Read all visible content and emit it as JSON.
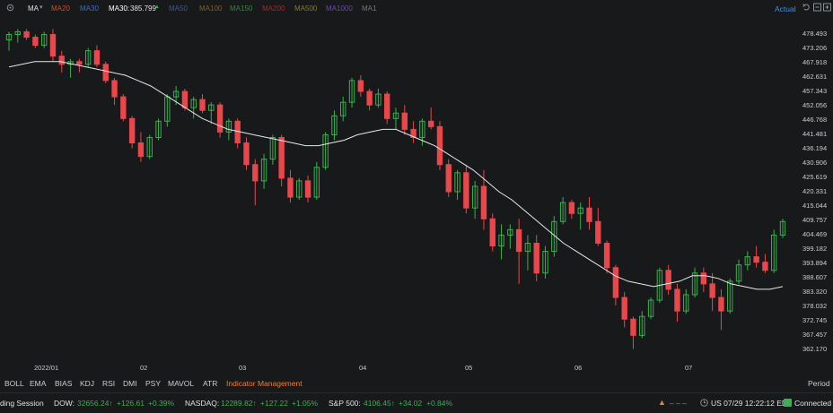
{
  "header": {
    "indicator_name": "MA",
    "ma_items": [
      {
        "label": "MA20",
        "color": "#b8573c",
        "value": ""
      },
      {
        "label": "MA30",
        "color": "#3f6fb1",
        "value": ""
      },
      {
        "label": "MA30:",
        "color": "#ffffff",
        "value": "385.799"
      },
      {
        "label": "MA50",
        "color": "#3a5a9a",
        "value": ""
      },
      {
        "label": "MA100",
        "color": "#8a5a2a",
        "value": ""
      },
      {
        "label": "MA150",
        "color": "#2f8a3f",
        "value": ""
      },
      {
        "label": "MA200",
        "color": "#a52a2a",
        "value": ""
      },
      {
        "label": "MA500",
        "color": "#8a7a2a",
        "value": ""
      },
      {
        "label": "MA1000",
        "color": "#6a4aa5",
        "value": ""
      },
      {
        "label": "MA1",
        "color": "#777777",
        "value": ""
      }
    ],
    "actual_label": "Actual"
  },
  "price_axis": [
    "478.493",
    "473.206",
    "467.918",
    "462.631",
    "457.343",
    "452.056",
    "446.768",
    "441.481",
    "436.194",
    "430.906",
    "425.619",
    "420.331",
    "415.044",
    "409.757",
    "404.469",
    "399.182",
    "393.894",
    "388.607",
    "383.320",
    "378.032",
    "372.745",
    "367.457",
    "362.170"
  ],
  "date_axis": [
    "2022/01",
    "02",
    "03",
    "04",
    "05",
    "06",
    "07"
  ],
  "indicator_tabs": [
    "BOLL",
    "EMA",
    "BIAS",
    "KDJ",
    "RSI",
    "DMI",
    "PSY",
    "MAVOL",
    "ATR",
    "Indicator Management"
  ],
  "period_label": "Period",
  "status": {
    "session": "ding Session",
    "dow_label": "DOW:",
    "dow_value": "32656.24↑",
    "dow_change": "+126.61",
    "dow_pct": "+0.39%",
    "nasdaq_label": "NASDAQ:",
    "nasdaq_value": "12289.82↑",
    "nasdaq_change": "+127.22",
    "nasdaq_pct": "+1.05%",
    "sp_label": "S&P 500:",
    "sp_value": "4106.45↑",
    "sp_change": "+34.02",
    "sp_pct": "+0.84%",
    "dashes": "– – –",
    "datetime": "US 07/29 12:22:12 EDT",
    "connection": "Connected"
  },
  "colors": {
    "up": "#34b34e",
    "down": "#e8474b",
    "ma": "#e8e8e8",
    "background": "#18191b",
    "accent": "#f27e2f",
    "actual": "#3d8ef0"
  },
  "chart_data": {
    "type": "candlestick",
    "ylim": [
      362.17,
      481
    ],
    "x_categories": [
      "2022/01",
      "02",
      "03",
      "04",
      "05",
      "06",
      "07"
    ],
    "ma_label": "MA30",
    "ma_last": 385.799,
    "candles": [
      [
        476,
        479,
        472,
        478
      ],
      [
        478,
        480,
        475,
        479
      ],
      [
        479,
        480,
        476,
        477
      ],
      [
        477,
        478,
        473,
        474
      ],
      [
        474,
        479,
        473,
        478
      ],
      [
        478,
        480,
        468,
        470
      ],
      [
        470,
        472,
        464,
        467
      ],
      [
        467,
        469,
        462,
        468
      ],
      [
        468,
        469,
        464,
        467
      ],
      [
        467,
        473,
        466,
        472
      ],
      [
        472,
        474,
        466,
        467
      ],
      [
        467,
        468,
        460,
        461
      ],
      [
        461,
        462,
        452,
        455
      ],
      [
        455,
        456,
        446,
        447
      ],
      [
        447,
        448,
        436,
        438
      ],
      [
        438,
        442,
        431,
        433
      ],
      [
        433,
        441,
        432,
        440
      ],
      [
        440,
        447,
        439,
        446
      ],
      [
        446,
        456,
        444,
        455
      ],
      [
        455,
        459,
        452,
        457
      ],
      [
        457,
        458,
        450,
        451
      ],
      [
        451,
        455,
        447,
        454
      ],
      [
        454,
        456,
        449,
        450
      ],
      [
        450,
        453,
        445,
        452
      ],
      [
        452,
        453,
        440,
        442
      ],
      [
        442,
        447,
        439,
        446
      ],
      [
        446,
        447,
        436,
        438
      ],
      [
        438,
        440,
        428,
        430
      ],
      [
        430,
        432,
        415,
        424
      ],
      [
        424,
        434,
        421,
        432
      ],
      [
        432,
        441,
        430,
        440
      ],
      [
        440,
        441,
        422,
        425
      ],
      [
        425,
        428,
        416,
        418
      ],
      [
        418,
        425,
        417,
        424
      ],
      [
        424,
        426,
        416,
        418
      ],
      [
        418,
        431,
        417,
        429
      ],
      [
        429,
        442,
        428,
        441
      ],
      [
        441,
        450,
        439,
        448
      ],
      [
        448,
        455,
        446,
        453
      ],
      [
        453,
        462,
        451,
        461
      ],
      [
        461,
        463,
        455,
        457
      ],
      [
        457,
        458,
        450,
        452
      ],
      [
        452,
        458,
        451,
        456
      ],
      [
        456,
        457,
        445,
        447
      ],
      [
        447,
        451,
        443,
        449
      ],
      [
        449,
        452,
        441,
        443
      ],
      [
        443,
        446,
        438,
        440
      ],
      [
        440,
        447,
        437,
        446
      ],
      [
        446,
        451,
        443,
        444
      ],
      [
        444,
        446,
        428,
        430
      ],
      [
        430,
        432,
        418,
        420
      ],
      [
        420,
        428,
        417,
        427
      ],
      [
        427,
        430,
        412,
        414
      ],
      [
        414,
        424,
        410,
        422
      ],
      [
        422,
        428,
        406,
        410
      ],
      [
        410,
        412,
        398,
        400
      ],
      [
        400,
        408,
        395,
        404
      ],
      [
        404,
        408,
        399,
        406
      ],
      [
        406,
        410,
        386,
        398
      ],
      [
        398,
        404,
        391,
        401
      ],
      [
        401,
        404,
        387,
        390
      ],
      [
        390,
        400,
        388,
        398
      ],
      [
        398,
        411,
        396,
        409
      ],
      [
        409,
        418,
        408,
        416
      ],
      [
        416,
        417,
        410,
        412
      ],
      [
        412,
        416,
        406,
        414
      ],
      [
        414,
        418,
        406,
        409
      ],
      [
        409,
        414,
        400,
        401
      ],
      [
        401,
        402,
        390,
        392
      ],
      [
        392,
        393,
        378,
        381
      ],
      [
        381,
        383,
        370,
        373
      ],
      [
        373,
        374,
        362,
        367
      ],
      [
        367,
        376,
        366,
        374
      ],
      [
        374,
        381,
        373,
        380
      ],
      [
        380,
        392,
        379,
        391
      ],
      [
        391,
        393,
        382,
        384
      ],
      [
        384,
        386,
        372,
        376
      ],
      [
        376,
        384,
        375,
        382
      ],
      [
        382,
        392,
        381,
        390
      ],
      [
        390,
        392,
        383,
        386
      ],
      [
        386,
        390,
        376,
        381
      ],
      [
        381,
        384,
        369,
        376
      ],
      [
        376,
        388,
        375,
        387
      ],
      [
        387,
        395,
        386,
        393
      ],
      [
        393,
        398,
        391,
        396
      ],
      [
        396,
        400,
        392,
        394
      ],
      [
        394,
        397,
        390,
        391
      ],
      [
        391,
        406,
        390,
        404
      ],
      [
        404,
        410,
        403,
        409
      ]
    ],
    "ma30": [
      466,
      467,
      468,
      468,
      468,
      467,
      466,
      465,
      464,
      463,
      461,
      459,
      456,
      453,
      450,
      447,
      445,
      443,
      442,
      441,
      440,
      439,
      438,
      437,
      437,
      438,
      439,
      441,
      442,
      443,
      443,
      441,
      439,
      437,
      434,
      431,
      428,
      424,
      420,
      417,
      413,
      409,
      405,
      401,
      398,
      395,
      392,
      389,
      387,
      386,
      385,
      386,
      387,
      389,
      389,
      388,
      386,
      385,
      384,
      384,
      385
    ]
  }
}
